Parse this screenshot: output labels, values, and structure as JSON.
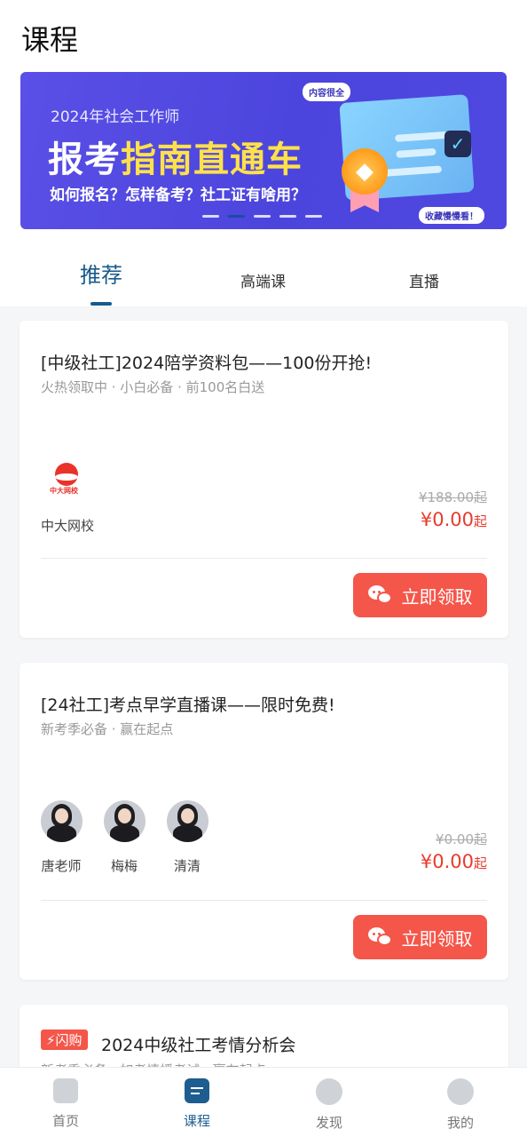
{
  "page": {
    "title": "课程"
  },
  "banner": {
    "year_text": "2024年社会工作师",
    "headline_white": "报考",
    "headline_yellow": "指南直通车",
    "subtitle": "如何报名？怎样备考？社工证有啥用？",
    "tag_top": "内容很全",
    "tag_bottom": "收藏慢慢看！",
    "slides": 5,
    "active_slide": 2
  },
  "tabs": [
    {
      "label": "推荐",
      "active": true
    },
    {
      "label": "高端课",
      "active": false
    },
    {
      "label": "直播",
      "active": false
    }
  ],
  "cards": [
    {
      "title": "[中级社工]2024陪学资料包——100份开抢!",
      "subtitle": "火热领取中 · 小白必备 · 前100名白送",
      "provider": {
        "name": "中大网校",
        "logo_text": "中大网校"
      },
      "price_old": "¥188.00起",
      "price_now": "¥0.00",
      "price_suffix": "起",
      "button_label": "立即领取"
    },
    {
      "title": "[24社工]考点早学直播课——限时免费!",
      "subtitle": "新考季必备 · 赢在起点",
      "teachers": [
        {
          "name": "唐老师"
        },
        {
          "name": "梅梅"
        },
        {
          "name": "清清"
        }
      ],
      "price_old": "¥0.00起",
      "price_now": "¥0.00",
      "price_suffix": "起",
      "button_label": "立即领取"
    },
    {
      "badge": "闪购",
      "title": "2024中级社工考情分析会",
      "subtitle": "新考季必备 · 如考情播考试 · 赢在起点"
    }
  ],
  "bottom_nav": [
    {
      "label": "首页",
      "icon": "home-icon",
      "active": false
    },
    {
      "label": "课程",
      "icon": "course-icon",
      "active": true
    },
    {
      "label": "发现",
      "icon": "compass-icon",
      "active": false
    },
    {
      "label": "我的",
      "icon": "profile-icon",
      "active": false
    }
  ],
  "colors": {
    "accent": "#185a8c",
    "price": "#e83b2c",
    "button": "#f5564a",
    "banner": "#4c45dd"
  }
}
